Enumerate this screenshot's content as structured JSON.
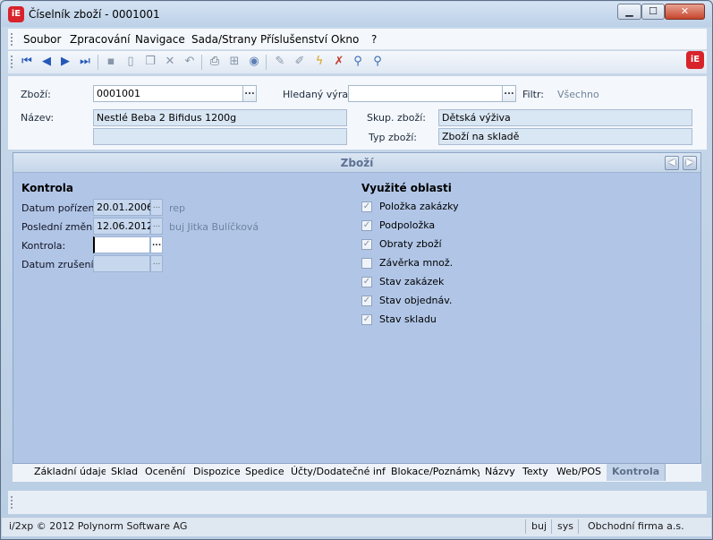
{
  "window": {
    "title": "Číselník zboží - 0001001",
    "logo": "iE",
    "min": "▁",
    "max": "☐",
    "close": "✕"
  },
  "menu": [
    "Soubor",
    "Zpracování",
    "Navigace",
    "Sada/Strany",
    "Příslušenství",
    "Okno",
    "?"
  ],
  "toolbar_icons": [
    "first-record-icon",
    "prev-record-icon",
    "next-record-icon",
    "last-record-icon",
    "save-icon",
    "new-icon",
    "copy-icon",
    "delete-icon",
    "undo-icon",
    "print-icon",
    "tree-icon",
    "globe-icon",
    "edit-icon",
    "pencil-icon",
    "filter-icon",
    "clear-filter-icon",
    "search-icon",
    "advanced-search-icon"
  ],
  "header": {
    "zbozi_label": "Zboží:",
    "zbozi_value": "0001001",
    "hledany_label": "Hledaný výraz:",
    "hledany_value": "",
    "filtr_label": "Filtr:",
    "filtr_value": "Všechno",
    "nazev_label": "Název:",
    "nazev_value": "Nestlé Beba 2 Bifidus 1200g",
    "nazev_value2": "",
    "skup_label": "Skup. zboží:",
    "skup_value": "Dětská výživa",
    "typ_label": "Typ zboží:",
    "typ_value": "Zboží na skladě"
  },
  "panel": {
    "title": "Zboží",
    "kontrola_title": "Kontrola",
    "datum_porizeni_label": "Datum pořízení:",
    "datum_porizeni_value": "20.01.2006",
    "datum_porizeni_user": "rep",
    "posledni_zmena_label": "Poslední změna:",
    "posledni_zmena_value": "12.06.2012",
    "posledni_zmena_user": "buj  Jitka Bulíčková",
    "kontrola_label": "Kontrola:",
    "kontrola_value": "",
    "datum_zruseni_label": "Datum zrušení:",
    "datum_zruseni_value": "",
    "oblasti_title": "Využité oblasti",
    "oblasti": [
      {
        "label": "Položka zakázky",
        "checked": true
      },
      {
        "label": "Podpoložka",
        "checked": true
      },
      {
        "label": "Obraty zboží",
        "checked": true
      },
      {
        "label": "Závěrka množ.",
        "checked": false
      },
      {
        "label": "Stav zakázek",
        "checked": true
      },
      {
        "label": "Stav objednáv.",
        "checked": true
      },
      {
        "label": "Stav skladu",
        "checked": true
      }
    ]
  },
  "tabs": [
    "Základní údaje",
    "Sklad",
    "Ocenění",
    "Dispozice",
    "Spedice",
    "Účty/Dodatečné info",
    "Blokace/Poznámky",
    "Názvy",
    "Texty",
    "Web/POS",
    "Kontrola"
  ],
  "active_tab": "Kontrola",
  "status": {
    "copyright": "i/2xp © 2012 Polynorm Software AG",
    "user": "buj",
    "system": "sys",
    "company": "Obchodní firma a.s."
  }
}
